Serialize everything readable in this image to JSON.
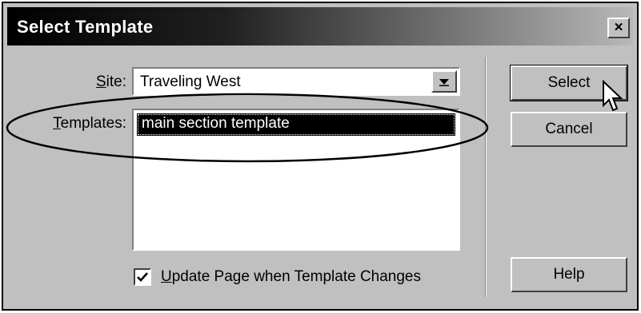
{
  "dialog": {
    "title": "Select Template",
    "close_glyph": "×"
  },
  "form": {
    "site_label_accel": "S",
    "site_label_rest": "ite:",
    "site_value": "Traveling West",
    "templates_label_accel": "T",
    "templates_label_rest": "emplates:",
    "templates": [
      {
        "name": "main section template",
        "selected": true
      }
    ],
    "update_checkbox_accel": "U",
    "update_checkbox_rest": "pdate Page when Template Changes",
    "update_checked": true
  },
  "buttons": {
    "select": "Select",
    "cancel": "Cancel",
    "help": "Help"
  },
  "icons": {
    "dropdown": "chevron-down-icon",
    "close": "close-icon",
    "checkmark": "checkmark-icon",
    "cursor": "mouse-pointer-icon"
  },
  "colors": {
    "title_bar_dark": "#000000",
    "title_bar_light": "#b8b8b8",
    "dialog_face": "#c0c0c0",
    "selection": "#000000"
  }
}
